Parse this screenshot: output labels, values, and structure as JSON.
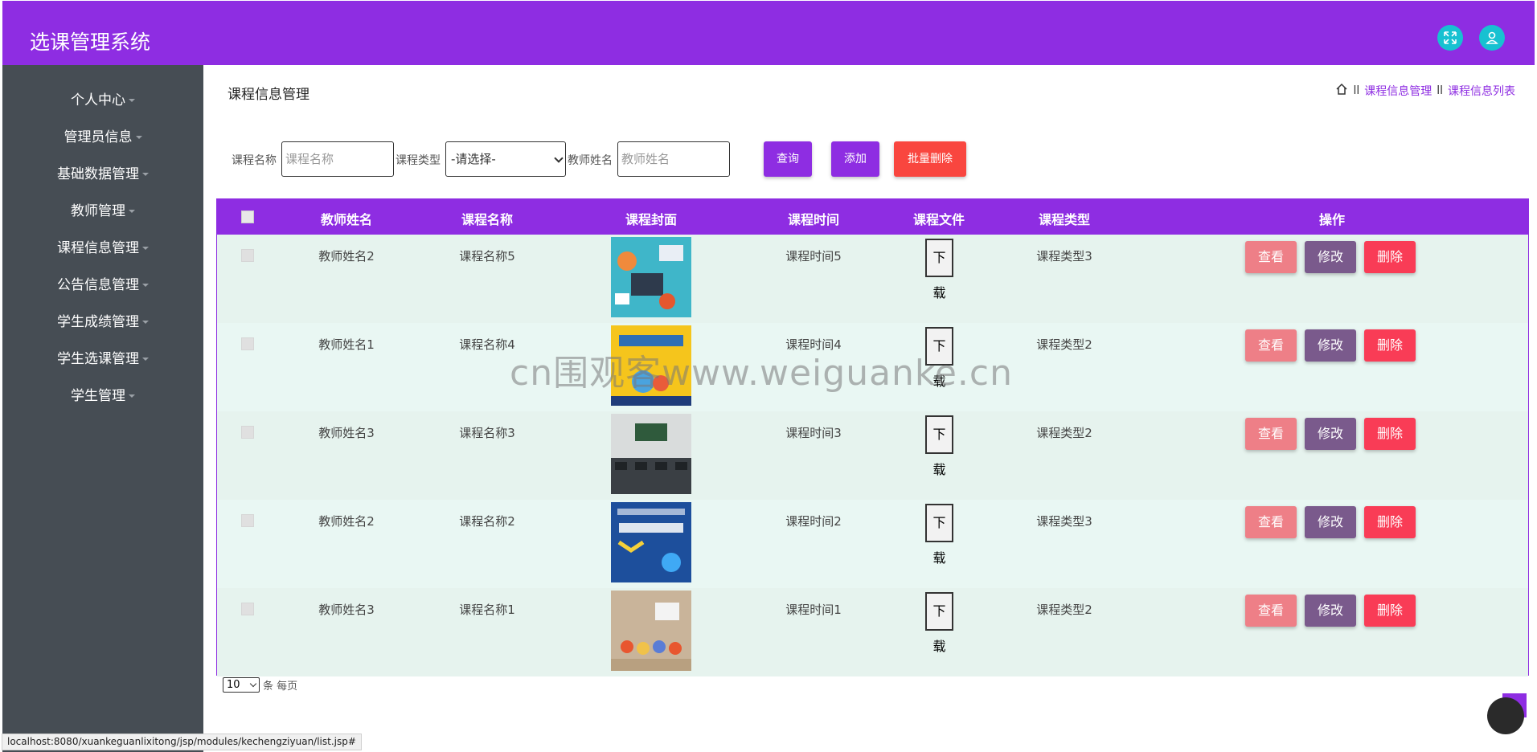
{
  "app": {
    "title": "选课管理系统",
    "accent_color": "#8e2de2",
    "icons": [
      "fullscreen-icon",
      "user-icon"
    ]
  },
  "sidebar": {
    "items": [
      {
        "label": "个人中心"
      },
      {
        "label": "管理员信息"
      },
      {
        "label": "基础数据管理"
      },
      {
        "label": "教师管理"
      },
      {
        "label": "课程信息管理"
      },
      {
        "label": "公告信息管理"
      },
      {
        "label": "学生成绩管理"
      },
      {
        "label": "学生选课管理"
      },
      {
        "label": "学生管理"
      }
    ]
  },
  "page": {
    "title": "课程信息管理",
    "breadcrumb": [
      "课程信息管理",
      "课程信息列表"
    ],
    "breadcrumb_sep": "ll"
  },
  "search": {
    "course_name_label": "课程名称",
    "course_name_placeholder": "课程名称",
    "course_type_label": "课程类型",
    "course_type_selected": "-请选择-",
    "teacher_name_label": "教师姓名",
    "teacher_name_placeholder": "教师姓名",
    "query_label": "查询",
    "add_label": "添加",
    "batch_delete_label": "批量删除"
  },
  "table": {
    "headers": [
      "教师姓名",
      "课程名称",
      "课程封面",
      "课程时间",
      "课程文件",
      "课程类型",
      "操作"
    ],
    "download_label": "下载",
    "view_label": "查看",
    "edit_label": "修改",
    "delete_label": "删除",
    "rows": [
      {
        "teacher": "教师姓名2",
        "course": "课程名称5",
        "time": "课程时间5",
        "type": "课程类型3"
      },
      {
        "teacher": "教师姓名1",
        "course": "课程名称4",
        "time": "课程时间4",
        "type": "课程类型2"
      },
      {
        "teacher": "教师姓名3",
        "course": "课程名称3",
        "time": "课程时间3",
        "type": "课程类型2"
      },
      {
        "teacher": "教师姓名2",
        "course": "课程名称2",
        "time": "课程时间2",
        "type": "课程类型3"
      },
      {
        "teacher": "教师姓名3",
        "course": "课程名称1",
        "time": "课程时间1",
        "type": "课程类型2"
      }
    ]
  },
  "pager": {
    "page_size": "10",
    "per_page_text": "条 每页"
  },
  "watermark": "cn围观客www.weiguanke.cn",
  "status_url": "localhost:8080/xuankeguanlixitong/jsp/modules/kechengziyuan/list.jsp#"
}
